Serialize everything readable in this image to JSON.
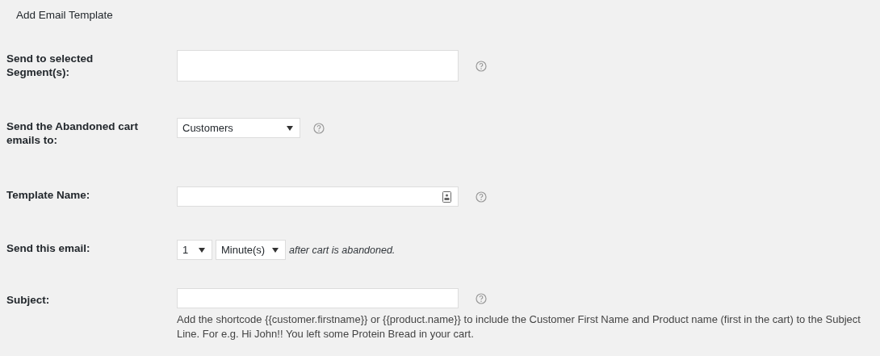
{
  "title": "Add Email Template",
  "rows": [
    {
      "label": "Send to selected Segment(s):",
      "controls": [
        {
          "kind": "multiselect"
        },
        {
          "kind": "help"
        }
      ]
    },
    {
      "label": "Send the Abandoned cart emails to:",
      "controls": [
        {
          "kind": "select",
          "value": "Customers"
        },
        {
          "kind": "help"
        }
      ]
    },
    {
      "label": "Template Name:",
      "controls": [
        {
          "kind": "input-badge"
        },
        {
          "kind": "help"
        }
      ]
    },
    {
      "label": "Send this email:",
      "controls": [
        {
          "kind": "select-small",
          "value": "1"
        },
        {
          "kind": "select-mid",
          "value": "Minute(s)"
        }
      ],
      "suffix": "after cart is abandoned."
    },
    {
      "label": "Subject:",
      "controls": [
        {
          "kind": "input"
        },
        {
          "kind": "help"
        }
      ],
      "help": "Add the shortcode {{customer.firstname}} or {{product.name}} to include the Customer First Name and Product name (first in the cart) to the Subject Line. For e.g. Hi John!! You left some Protein Bread in your cart."
    }
  ]
}
